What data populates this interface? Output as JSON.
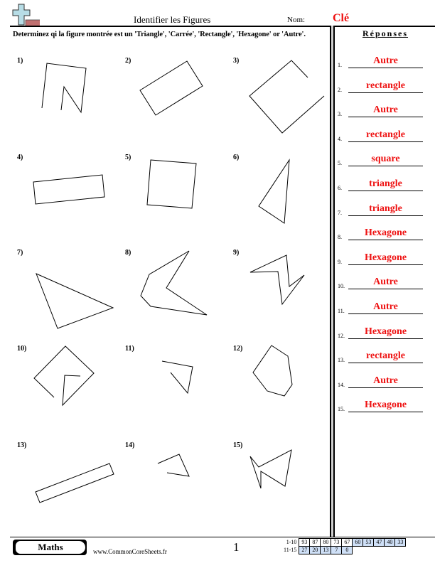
{
  "header": {
    "title": "Identifier les Figures",
    "nom_label": "Nom:",
    "nom_value": "Clé"
  },
  "instructions": "Determinez qi la figure montrée est un 'Triangle', 'Carrée', 'Rectangle', 'Hexagone' or 'Autre'.",
  "answers": {
    "title": "Réponses",
    "items": [
      {
        "num": "1.",
        "value": "Autre"
      },
      {
        "num": "2.",
        "value": "rectangle"
      },
      {
        "num": "3.",
        "value": "Autre"
      },
      {
        "num": "4.",
        "value": "rectangle"
      },
      {
        "num": "5.",
        "value": "square"
      },
      {
        "num": "6.",
        "value": "triangle"
      },
      {
        "num": "7.",
        "value": "triangle"
      },
      {
        "num": "8.",
        "value": "Hexagone"
      },
      {
        "num": "9.",
        "value": "Hexagone"
      },
      {
        "num": "10.",
        "value": "Autre"
      },
      {
        "num": "11.",
        "value": "Autre"
      },
      {
        "num": "12.",
        "value": "Hexagone"
      },
      {
        "num": "13.",
        "value": "rectangle"
      },
      {
        "num": "14.",
        "value": "Autre"
      },
      {
        "num": "15.",
        "value": "Hexagone"
      }
    ]
  },
  "questions": [
    {
      "label": "1)"
    },
    {
      "label": "2)"
    },
    {
      "label": "3)"
    },
    {
      "label": "4)"
    },
    {
      "label": "5)"
    },
    {
      "label": "6)"
    },
    {
      "label": "7)"
    },
    {
      "label": "8)"
    },
    {
      "label": "9)"
    },
    {
      "label": "10)"
    },
    {
      "label": "11)"
    },
    {
      "label": "12)"
    },
    {
      "label": "13)"
    },
    {
      "label": "14)"
    },
    {
      "label": "15)"
    }
  ],
  "footer": {
    "badge": "Maths",
    "site": "www.CommonCoreSheets.fr",
    "page": "1",
    "score_rows": [
      {
        "label": "1-10",
        "cells": [
          "93",
          "87",
          "80",
          "73",
          "67",
          "60",
          "53",
          "47",
          "40",
          "33"
        ]
      },
      {
        "label": "11-15",
        "cells": [
          "27",
          "20",
          "13",
          "7",
          "0"
        ]
      }
    ]
  },
  "colors": {
    "answer_red": "#ee1111",
    "score_blue": "#cfe0f7",
    "logo_cross": "#b7dde6",
    "logo_bar": "#c07070"
  }
}
